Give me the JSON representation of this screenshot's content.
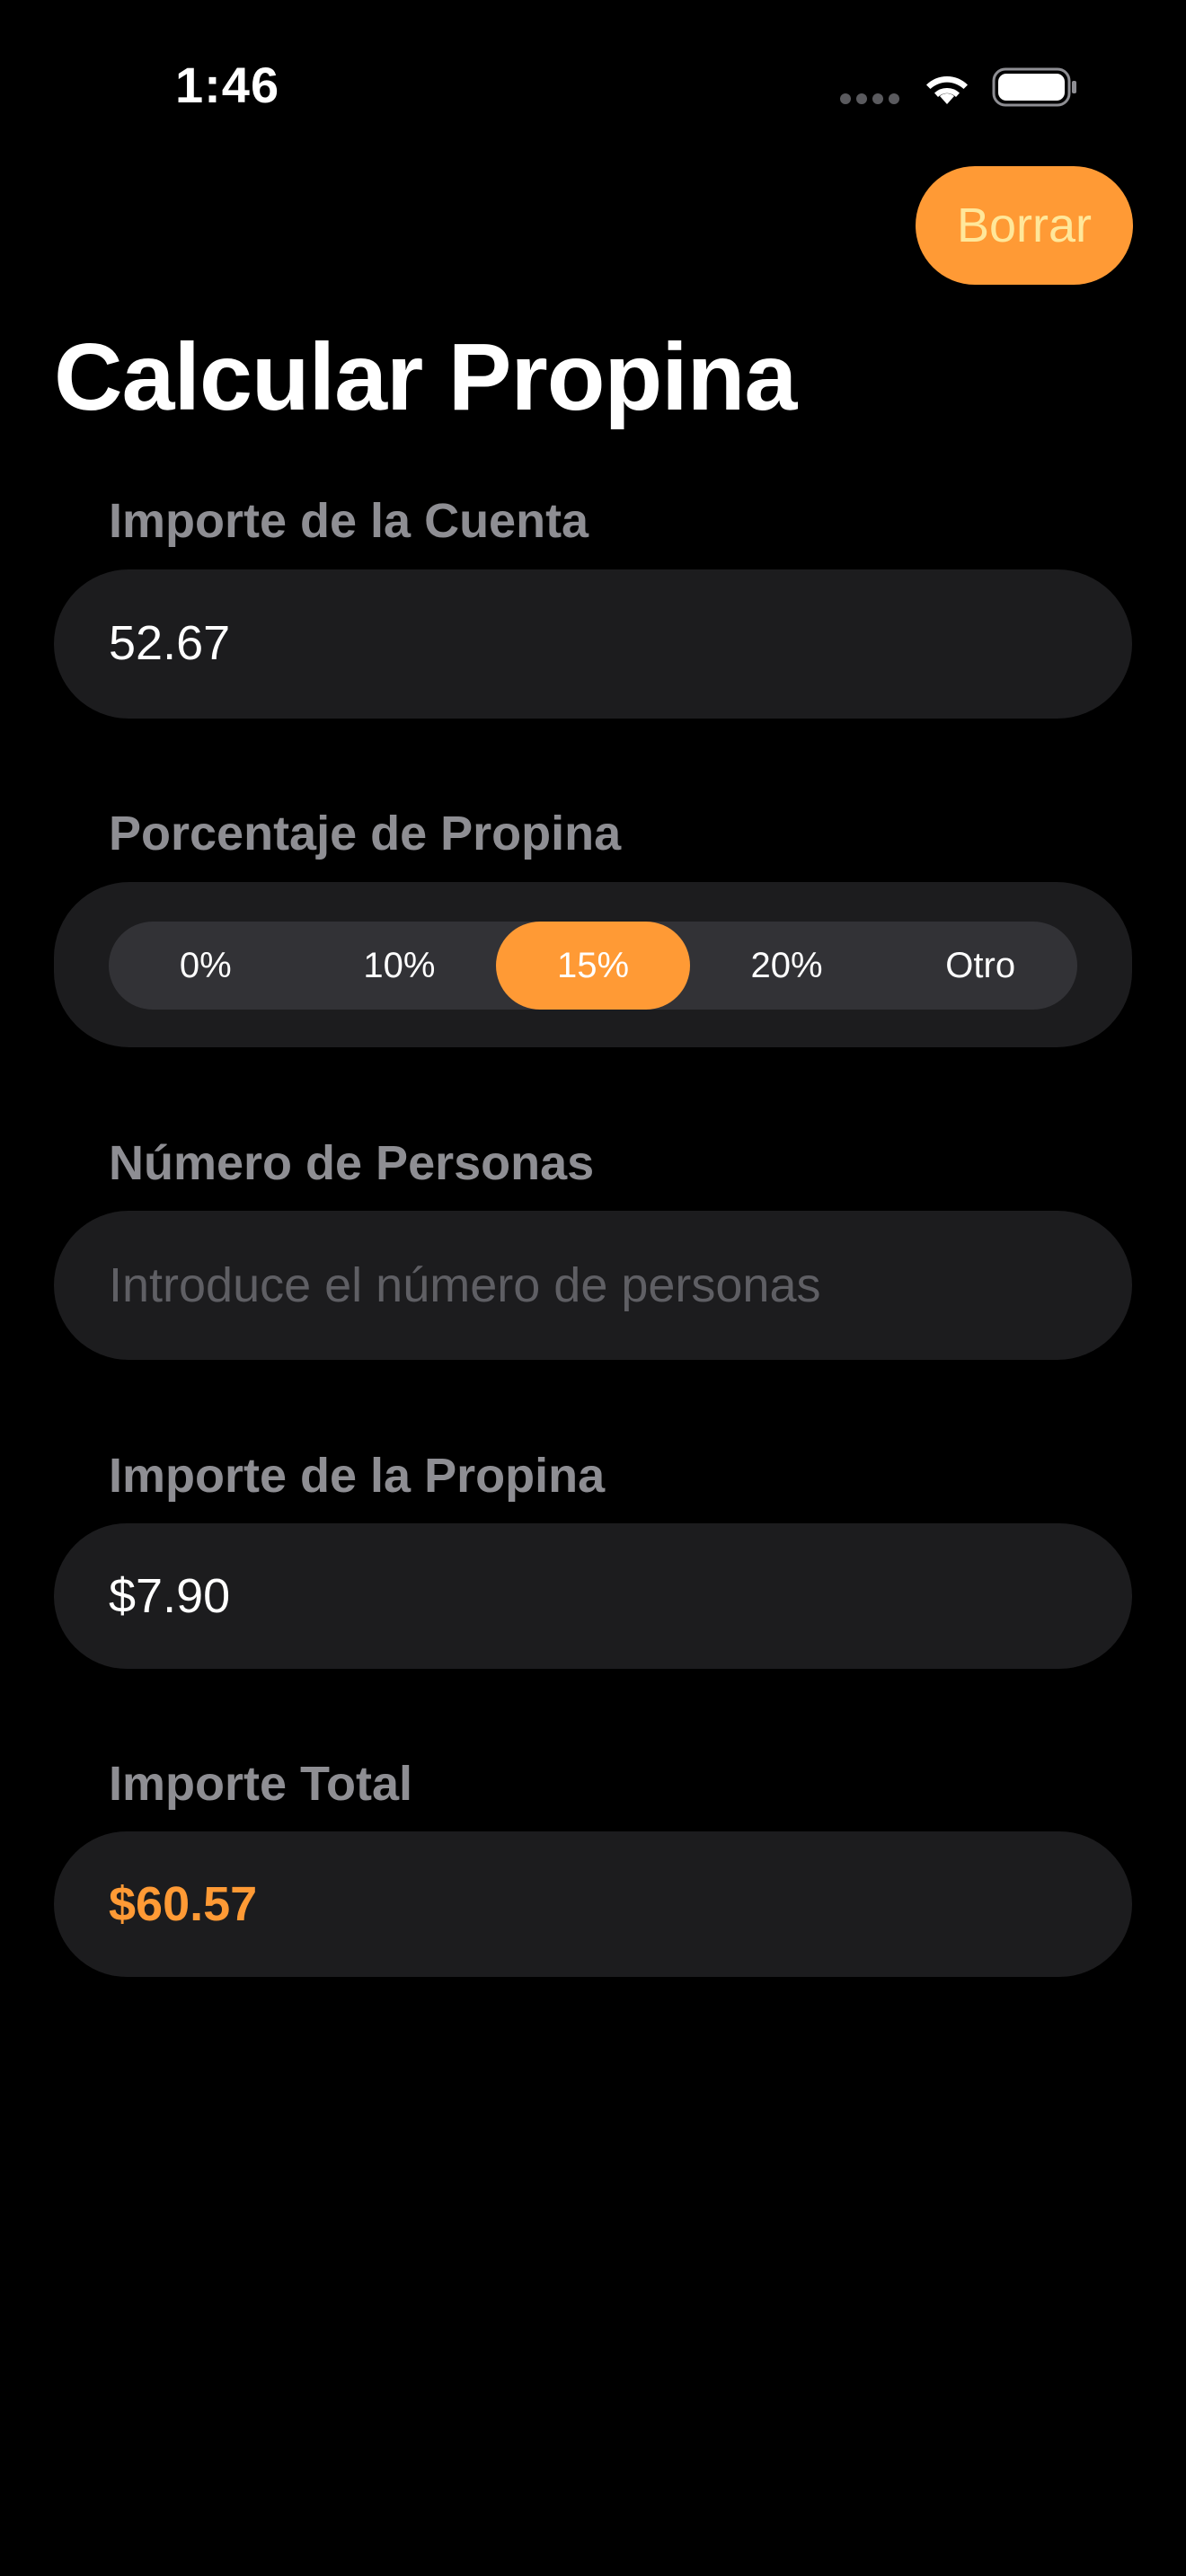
{
  "status_bar": {
    "time": "1:46"
  },
  "header": {
    "clear_label": "Borrar",
    "title": "Calcular Propina"
  },
  "bill": {
    "label": "Importe de la Cuenta",
    "value": "52.67"
  },
  "tip_percentage": {
    "label": "Porcentaje de Propina",
    "options": [
      "0%",
      "10%",
      "15%",
      "20%",
      "Otro"
    ],
    "selected": "15%"
  },
  "people": {
    "label": "Número de Personas",
    "placeholder": "Introduce el número de personas",
    "value": ""
  },
  "tip_amount": {
    "label": "Importe de la Propina",
    "value": "$7.90"
  },
  "total": {
    "label": "Importe Total",
    "value": "$60.57"
  },
  "colors": {
    "accent": "#ff9a35",
    "background": "#000000",
    "field_background": "#1c1c1e",
    "label": "#8e8e93"
  }
}
